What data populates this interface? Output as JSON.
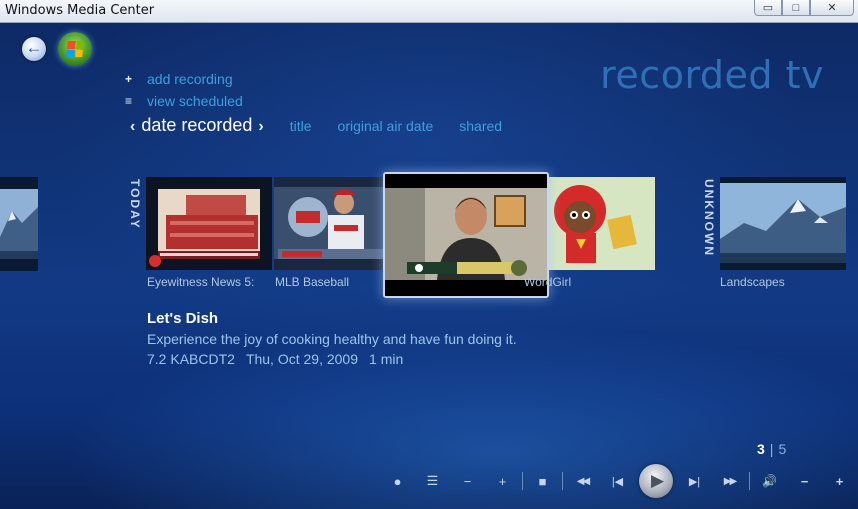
{
  "window": {
    "title": "Windows Media Center"
  },
  "header": {
    "page_title": "recorded tv"
  },
  "actions": [
    {
      "glyph": "+",
      "label": "add recording"
    },
    {
      "glyph": "≡",
      "label": "view scheduled"
    }
  ],
  "sort": {
    "active": "date recorded",
    "prev_arrow": "‹",
    "next_arrow": "›",
    "options": [
      "title",
      "original air date",
      "shared"
    ]
  },
  "groups": {
    "today": "TODAY",
    "unknown": "UNKNOWN"
  },
  "tiles": [
    {
      "caption": "Eyewitness News 5:"
    },
    {
      "caption": "MLB Baseball"
    },
    {
      "caption": "WordGirl"
    },
    {
      "caption": "Landscapes"
    }
  ],
  "selected": {
    "title": "Let's Dish",
    "description": "Experience the joy of cooking healthy and have fun doing it.",
    "channel": "7.2 KABCDT2",
    "date": "Thu, Oct 29, 2009",
    "duration": "1 min"
  },
  "pager": {
    "current": "3",
    "separator": "|",
    "total": "5"
  },
  "controls": {
    "record": "●",
    "guide": "☰",
    "channel_down": "−",
    "channel_up": "+",
    "stop": "■",
    "rewind": "◀◀",
    "skip_back": "|◀",
    "play": "▶",
    "skip_forward": "▶|",
    "fast_forward": "▶▶",
    "volume": "🔊",
    "volume_down": "−",
    "volume_up": "+"
  }
}
